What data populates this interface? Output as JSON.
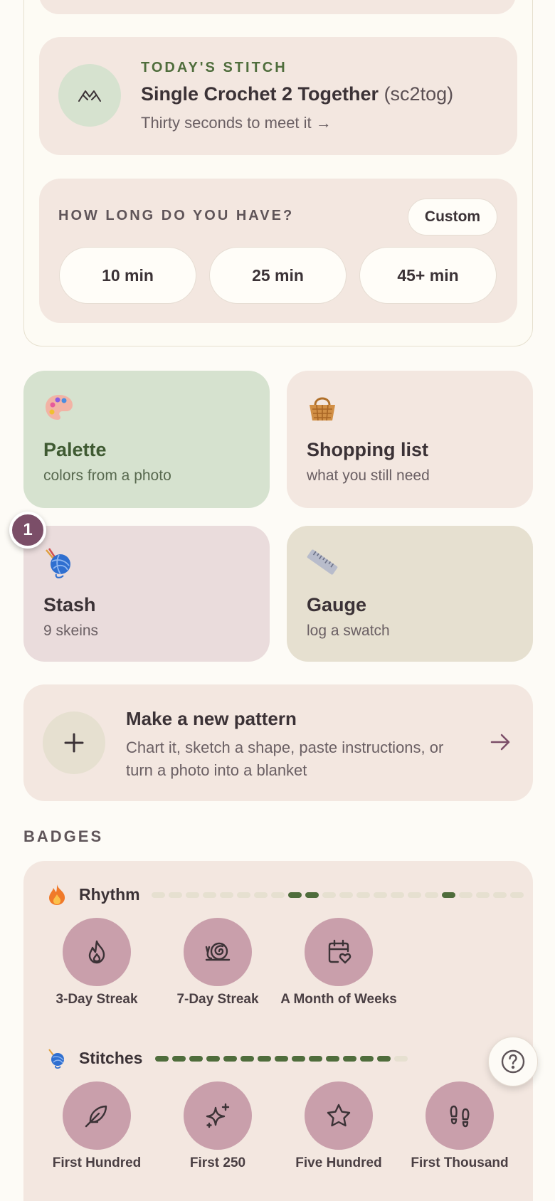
{
  "todays_stitch": {
    "eyebrow": "TODAY'S STITCH",
    "name": "Single Crochet 2 Together",
    "abbreviation": "(sc2tog)",
    "subtitle": "Thirty seconds to meet it →"
  },
  "time_picker": {
    "question": "HOW LONG DO YOU HAVE?",
    "custom_label": "Custom",
    "options": [
      "10 min",
      "25 min",
      "45+ min"
    ]
  },
  "tiles": {
    "palette": {
      "title": "Palette",
      "subtitle": "colors from a photo",
      "icon": "palette-icon"
    },
    "shopping": {
      "title": "Shopping list",
      "subtitle": "what you still need",
      "icon": "basket-icon"
    },
    "stash": {
      "title": "Stash",
      "subtitle": "9 skeins",
      "icon": "yarn-icon"
    },
    "gauge": {
      "title": "Gauge",
      "subtitle": "log a swatch",
      "icon": "ruler-icon"
    }
  },
  "step_badge": "1",
  "new_pattern": {
    "title": "Make a new pattern",
    "subtitle": "Chart it, sketch a shape, paste instructions, or turn a photo into a blanket"
  },
  "badges": {
    "heading": "BADGES",
    "rhythm": {
      "name": "Rhythm",
      "progress": [
        0,
        0,
        0,
        0,
        0,
        0,
        0,
        0,
        1,
        1,
        0,
        0,
        0,
        0,
        0,
        0,
        0,
        1,
        0,
        0,
        0,
        0
      ],
      "items": [
        "3-Day Streak",
        "7-Day Streak",
        "A Month of Weeks"
      ]
    },
    "stitches": {
      "name": "Stitches",
      "progress": [
        1,
        1,
        1,
        1,
        1,
        1,
        1,
        1,
        1,
        1,
        1,
        1,
        1,
        1,
        0
      ],
      "items": [
        "First Hundred",
        "First 250",
        "Five Hundred",
        "First Thousand"
      ]
    }
  },
  "colors": {
    "accent_green": "#4f6d3c",
    "badge_pink": "#c99fab",
    "plum": "#7b4e68"
  }
}
